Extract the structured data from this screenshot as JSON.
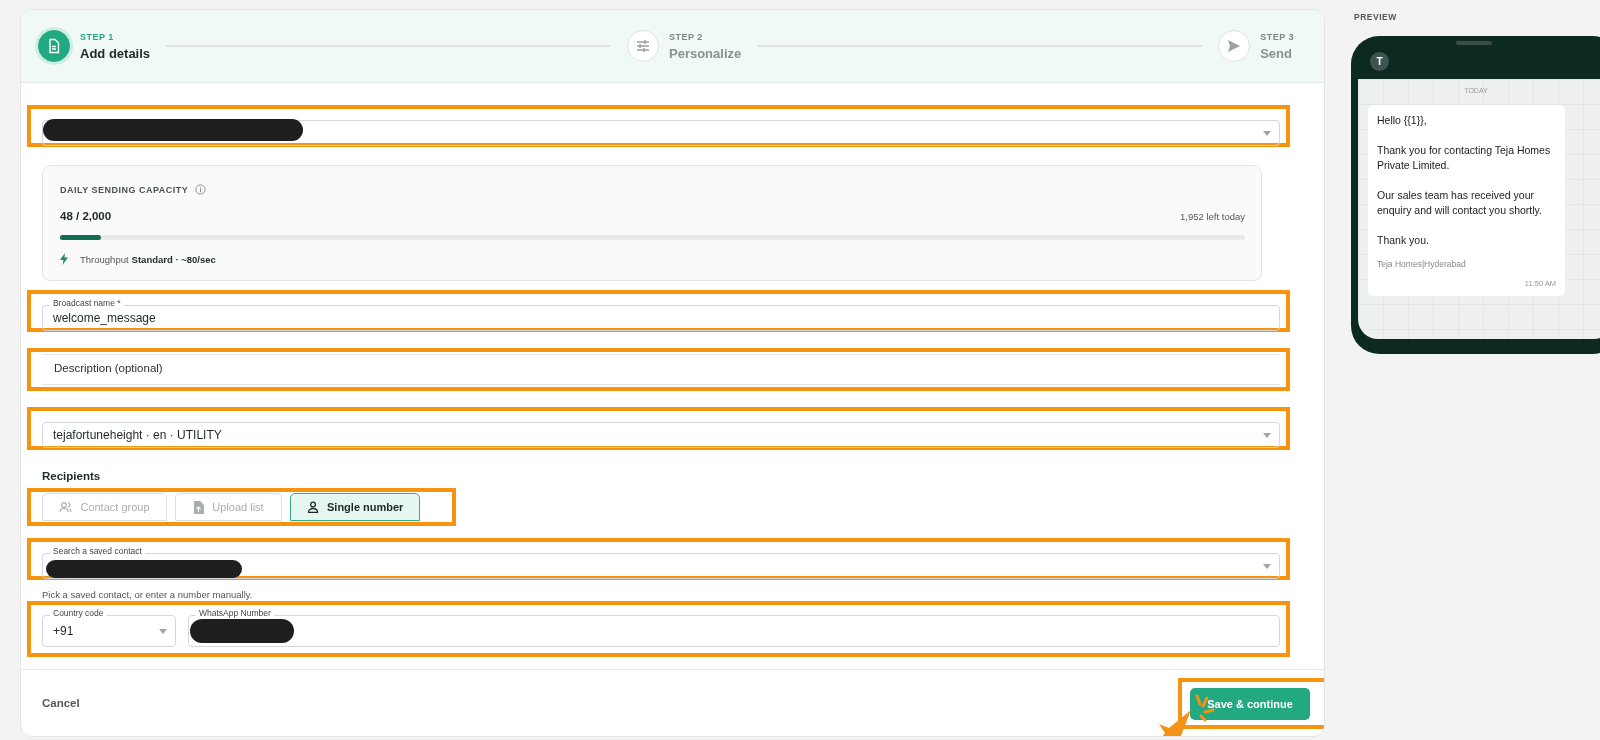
{
  "stepper": [
    {
      "step": "STEP 1",
      "title": "Add details",
      "selected": true
    },
    {
      "step": "STEP 2",
      "title": "Personalize",
      "selected": false
    },
    {
      "step": "STEP 3",
      "title": "Send",
      "selected": false
    }
  ],
  "capacity": {
    "title": "DAILY SENDING CAPACITY",
    "count": "48 / 2,000",
    "remaining": "1,952 left today",
    "level": 0.035,
    "throughput_label": "Throughput",
    "throughput_value": "Standard · ~80/sec"
  },
  "broadcast_name": {
    "label": "Broadcast name *",
    "value": "welcome_message"
  },
  "description": {
    "placeholder": "Description (optional)"
  },
  "template": {
    "value": "tejafortuneheight · en · UTILITY"
  },
  "recipients": {
    "title": "Recipients",
    "tabs": [
      {
        "label": "Contact group",
        "selected": false
      },
      {
        "label": "Upload list",
        "selected": false
      },
      {
        "label": "Single number",
        "selected": true
      }
    ],
    "search_label": "Search a saved contact",
    "helper": "Pick a saved contact, or enter a number manually.",
    "country_code": {
      "label": "Country code",
      "value": "+91"
    },
    "whatsapp_number": {
      "label": "WhatsApp Number"
    }
  },
  "footer": {
    "cancel": "Cancel",
    "save": "Save & continue"
  },
  "preview": {
    "title": "PREVIEW",
    "avatar": "T",
    "day": "TODAY",
    "paragraphs": [
      "Hello {{1}},",
      "Thank you for contacting Teja Homes Private Limited.",
      "Our sales team has received your enquiry and will contact you shortly.",
      "Thank you."
    ],
    "signature": "Teja Homes|Hyderabad",
    "time": "11:50 AM"
  }
}
